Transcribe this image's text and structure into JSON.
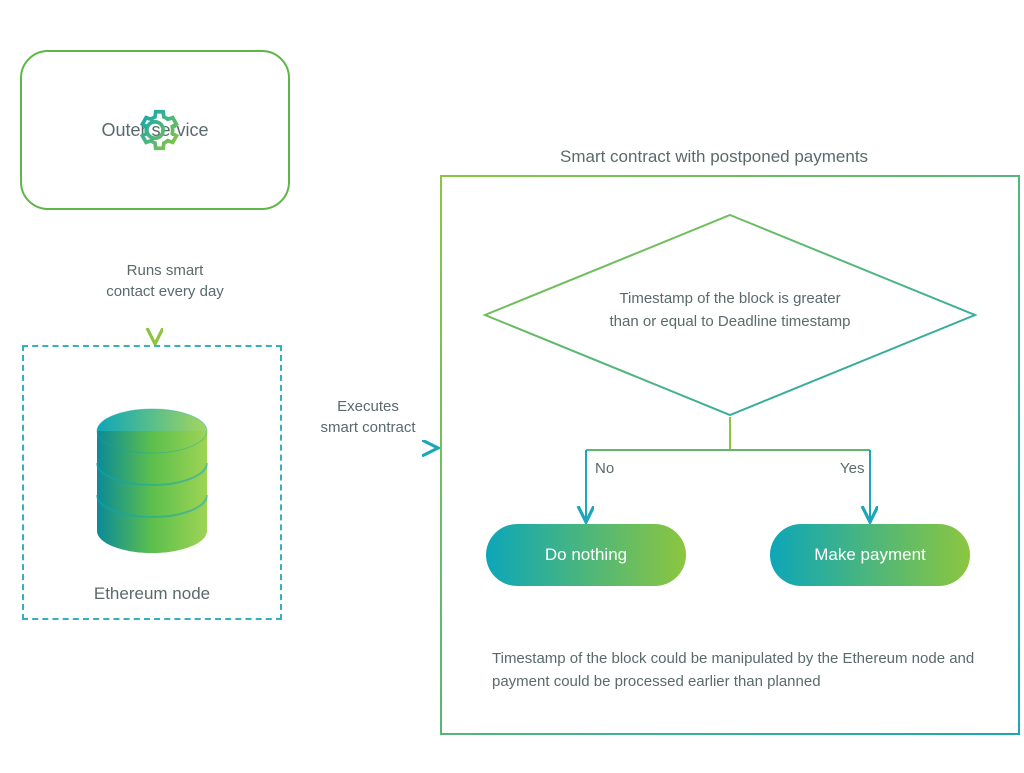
{
  "nodes": {
    "outer_service": "Outer service",
    "ethereum_node": "Ethereum node",
    "smart_contract_title": "Smart contract with postponed payments",
    "decision_line1": "Timestamp of the block is greater",
    "decision_line2": "than or equal to Deadline timestamp",
    "do_nothing": "Do nothing",
    "make_payment": "Make payment"
  },
  "arrows": {
    "run_line1": "Runs smart",
    "run_line2": "contact every day",
    "execute_line1": "Executes",
    "execute_line2": "smart contract",
    "no": "No",
    "yes": "Yes"
  },
  "footnote": "Timestamp of the block could be manipulated by the Ethereum node and payment could be  processed earlier than planned"
}
